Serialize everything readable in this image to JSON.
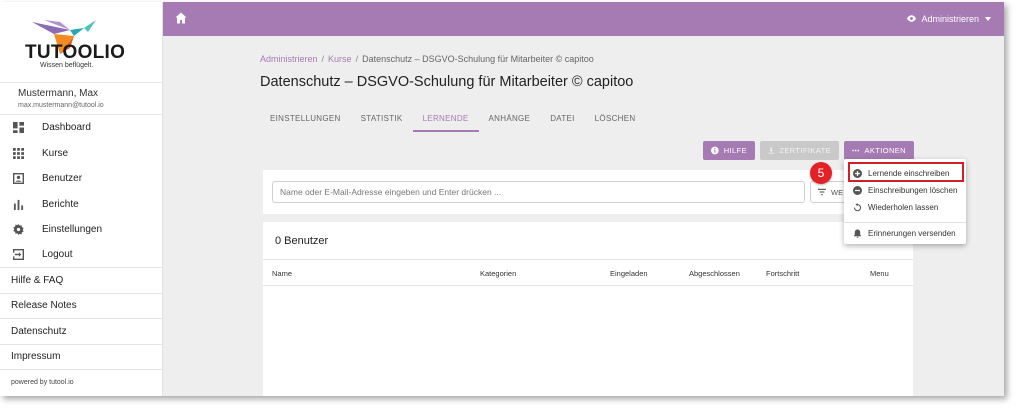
{
  "brand": {
    "name": "TUTOOLIO",
    "tagline": "Wissen beflügelt."
  },
  "user": {
    "name": "Mustermann, Max",
    "email": "max.mustermann@tutool.io"
  },
  "sidebar": {
    "items": [
      {
        "label": "Dashboard",
        "icon": "dashboard-icon"
      },
      {
        "label": "Kurse",
        "icon": "grid-icon"
      },
      {
        "label": "Benutzer",
        "icon": "user-icon"
      },
      {
        "label": "Berichte",
        "icon": "bar-chart-icon"
      },
      {
        "label": "Einstellungen",
        "icon": "gear-icon"
      },
      {
        "label": "Logout",
        "icon": "logout-icon"
      }
    ],
    "links": [
      "Hilfe & FAQ",
      "Release Notes",
      "Datenschutz",
      "Impressum"
    ],
    "powered": "powered by tutool.io"
  },
  "topbar": {
    "admin_label": "Administrieren"
  },
  "breadcrumb": {
    "level1": "Administrieren",
    "level2": "Kurse",
    "current": "Datenschutz – DSGVO-Schulung für Mitarbeiter © capitoo"
  },
  "page": {
    "title": "Datenschutz – DSGVO-Schulung für Mitarbeiter © capitoo"
  },
  "tabs": [
    "EINSTELLUNGEN",
    "STATISTIK",
    "LERNENDE",
    "ANHÄNGE",
    "DATEI",
    "LÖSCHEN"
  ],
  "active_tab": "LERNENDE",
  "buttons": {
    "help": "HILFE",
    "certificates": "ZERTIFIKATE",
    "actions": "AKTIONEN"
  },
  "search": {
    "placeholder": "Name oder E-Mail-Adresse eingeben und Enter drücken ...",
    "filter_label": "WE"
  },
  "users": {
    "count_label": "0 Benutzer",
    "columns": [
      "Name",
      "Kategorien",
      "Eingeladen",
      "Abgeschlossen",
      "Fortschritt",
      "Menu"
    ]
  },
  "actions_menu": {
    "items": [
      {
        "label": "Lernende einschreiben",
        "icon": "plus-circle-icon"
      },
      {
        "label": "Einschreibungen löschen",
        "icon": "minus-circle-icon"
      },
      {
        "label": "Wiederholen lassen",
        "icon": "refresh-icon"
      },
      {
        "label": "Erinnerungen versenden",
        "icon": "bell-icon"
      }
    ]
  },
  "step_badge": "5",
  "colors": {
    "accent": "#a67bb3",
    "highlight": "#d21e26",
    "badge": "#e32227"
  }
}
